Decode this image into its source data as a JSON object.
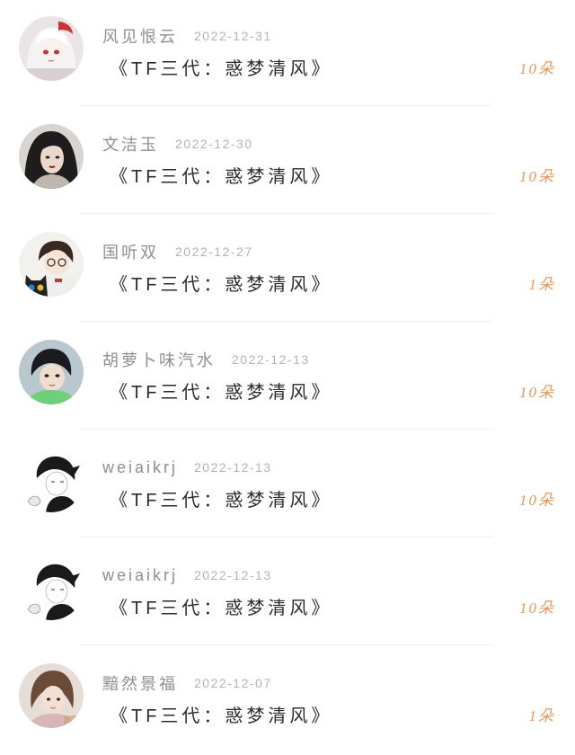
{
  "colors": {
    "background": "#ffffff",
    "username": "#8f8f8f",
    "date": "#b3b3b3",
    "gift_text": "#2b2b2b",
    "count": "#e29860",
    "divider": "#efefef"
  },
  "gift_list": {
    "items": [
      {
        "username": "风见恨云",
        "date": "2022-12-31",
        "gift": "《TF三代：惑梦清风》",
        "count": "10朵",
        "avatar_icon": "avatar-white-hair-girl"
      },
      {
        "username": "文洁玉",
        "date": "2022-12-30",
        "gift": "《TF三代：惑梦清风》",
        "count": "10朵",
        "avatar_icon": "avatar-dark-hair-woman"
      },
      {
        "username": "国听双",
        "date": "2022-12-27",
        "gift": "《TF三代：惑梦清风》",
        "count": "1朵",
        "avatar_icon": "avatar-boy-with-cat"
      },
      {
        "username": "胡萝卜味汽水",
        "date": "2022-12-13",
        "gift": "《TF三代：惑梦清风》",
        "count": "10朵",
        "avatar_icon": "avatar-boy-green"
      },
      {
        "username": "weiaikrj",
        "date": "2022-12-13",
        "gift": "《TF三代：惑梦清风》",
        "count": "10朵",
        "avatar_icon": "avatar-boy-sketch"
      },
      {
        "username": "weiaikrj",
        "date": "2022-12-13",
        "gift": "《TF三代：惑梦清风》",
        "count": "10朵",
        "avatar_icon": "avatar-boy-sketch"
      },
      {
        "username": "黯然景福",
        "date": "2022-12-07",
        "gift": "《TF三代：惑梦清风》",
        "count": "1朵",
        "avatar_icon": "avatar-girl-brown-hair"
      }
    ]
  }
}
